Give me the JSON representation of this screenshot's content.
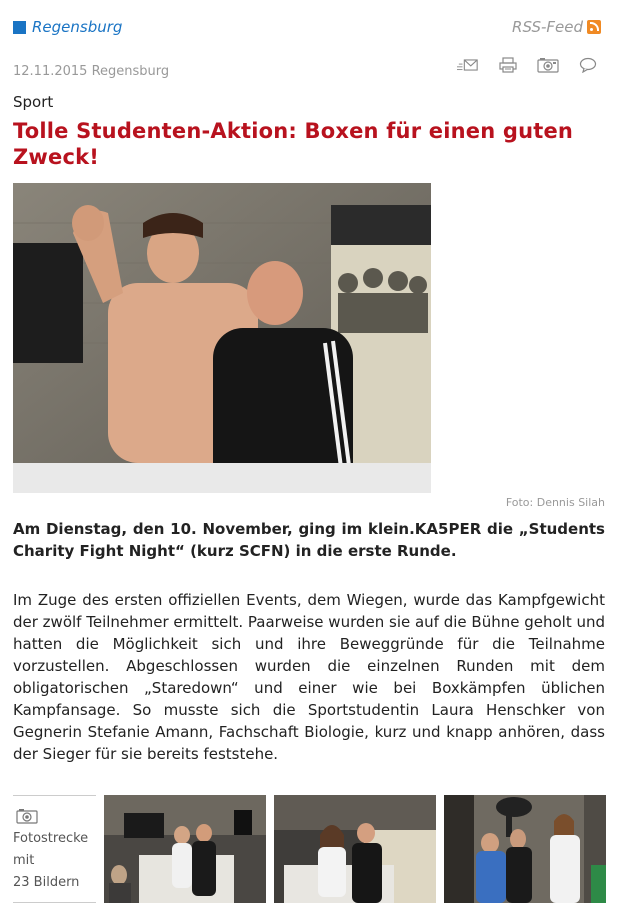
{
  "header": {
    "location": "Regensburg",
    "rss_label": "RSS-Feed"
  },
  "meta": {
    "date_line": "12.11.2015 Regensburg",
    "tools": [
      "email-icon",
      "print-icon",
      "camera-icon",
      "comment-icon"
    ]
  },
  "article": {
    "category": "Sport",
    "title": "Tolle Studenten-Aktion: Boxen für einen guten Zweck!",
    "photo_caption": "Foto: Dennis Silah",
    "lead": "Am Dienstag, den 10. November, ging im klein.KA5PER die „Students Charity Fight Night“ (kurz SCFN) in die erste Runde.",
    "body": "Im Zuge des ersten offiziellen Events, dem Wiegen, wurde das Kampfgewicht der zwölf Teilnehmer ermittelt. Paarweise wurden sie auf die Bühne geholt und hatten die Möglichkeit sich und ihre Beweggründe für die Teilnahme vorzustellen. Abgeschlossen wurden die einzelnen Runden mit dem obligatorischen „Staredown“ und einer wie bei Boxkämpfen üblichen Kampfansage. So musste sich die Sportstudentin Laura Henschker von Gegnerin Stefanie Amann, Fachschaft Biologie, kurz und knapp anhören, dass der Sieger für sie bereits feststehe."
  },
  "gallery": {
    "label_line1": "Fotostrecke",
    "label_line2": "mit",
    "label_line3": "23 Bildern"
  },
  "colors": {
    "accent_blue": "#1a74c4",
    "headline_red": "#b8121e",
    "rss_orange": "#f08a24",
    "muted": "#999999"
  }
}
